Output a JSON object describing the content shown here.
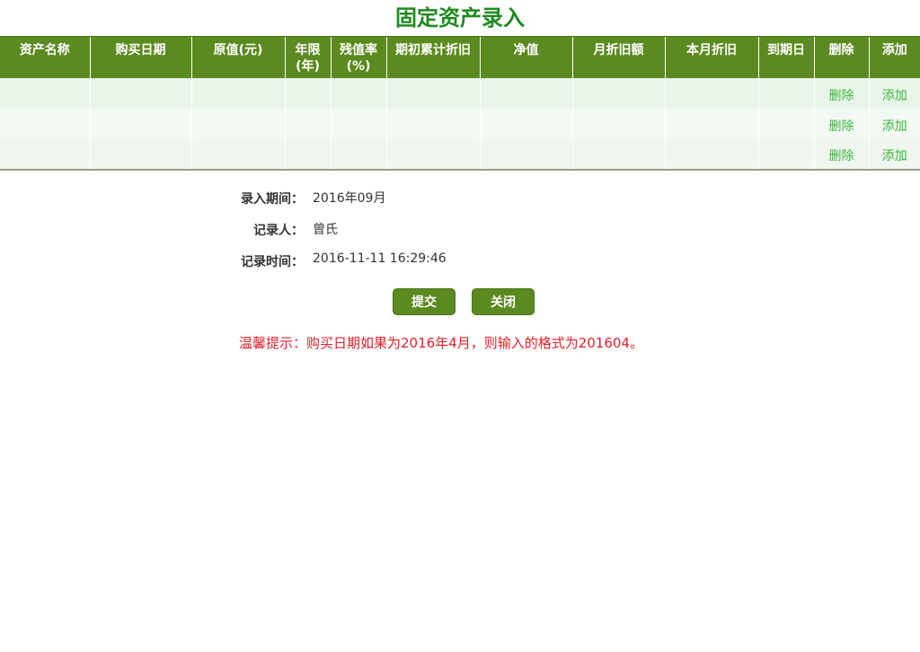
{
  "title": "固定资产录入",
  "table": {
    "headers": [
      "资产名称",
      "购买日期",
      "原值(元)",
      "年限(年)",
      "残值率(%)",
      "期初累计折旧",
      "净值",
      "月折旧额",
      "本月折旧",
      "到期日",
      "删除",
      "添加"
    ],
    "rows": [
      {
        "delete_label": "删除",
        "add_label": "添加"
      },
      {
        "delete_label": "删除",
        "add_label": "添加"
      },
      {
        "delete_label": "删除",
        "add_label": "添加"
      }
    ]
  },
  "info": {
    "period_label": "录入期间：",
    "period_value": "2016年09月",
    "recorder_label": "记录人：",
    "recorder_value": "曾氏",
    "record_time_label": "记录时间：",
    "record_time_value": "2016-11-11 16:29:46"
  },
  "buttons": {
    "submit": "提交",
    "close": "关闭"
  },
  "hint": "温馨提示：购买日期如果为2016年4月，则输入的格式为201604。",
  "colors": {
    "header_bg": "#5b8a1f",
    "title": "#1e8a1e",
    "link": "#3cb43c",
    "hint": "#e0202a"
  }
}
